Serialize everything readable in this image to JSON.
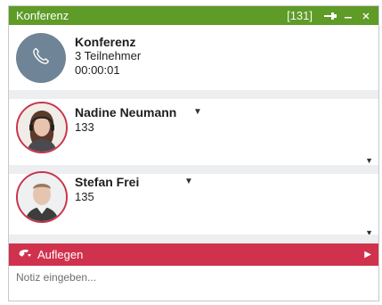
{
  "titlebar": {
    "title": "Konferenz",
    "ext": "[131]"
  },
  "conference": {
    "name": "Konferenz",
    "participants": "3 Teilnehmer",
    "duration": "00:00:01"
  },
  "participants": [
    {
      "name": "Nadine Neumann",
      "ext": "133"
    },
    {
      "name": "Stefan Frei",
      "ext": "135"
    }
  ],
  "actions": {
    "hangup_label": "Auflegen"
  },
  "note": {
    "placeholder": "Notiz eingeben..."
  },
  "colors": {
    "titlebar": "#5f9b27",
    "hangup": "#d0324e",
    "avatar_ring": "#c8334a",
    "conference_avatar": "#6f8496"
  }
}
